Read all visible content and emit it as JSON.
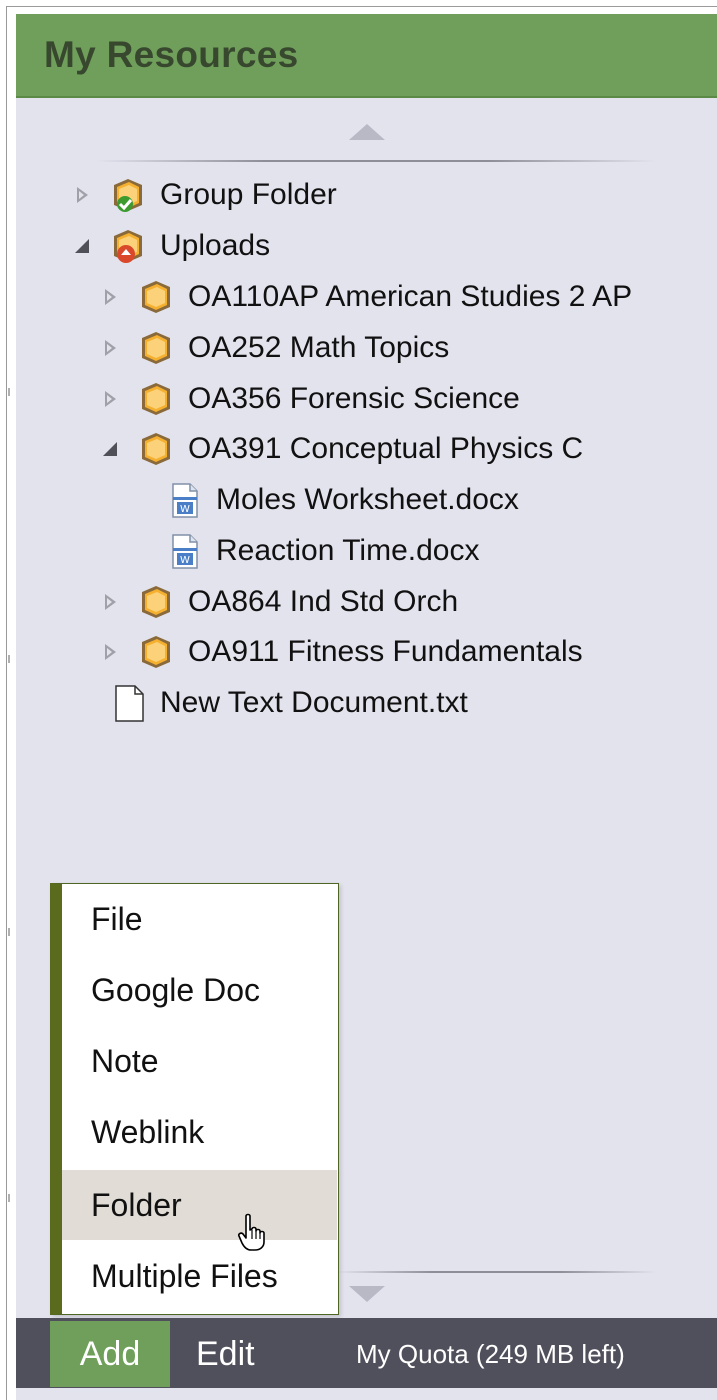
{
  "panel": {
    "title": "My Resources"
  },
  "tree": {
    "group_folder": "Group Folder",
    "uploads": "Uploads",
    "course_1": "OA110AP American Studies 2 AP",
    "course_2": "OA252 Math Topics",
    "course_3": "OA356 Forensic Science",
    "course_4": "OA391 Conceptual Physics C",
    "file_1": "Moles Worksheet.docx",
    "file_2": "Reaction Time.docx",
    "course_5": "OA864 Ind Std Orch",
    "course_6": "OA911 Fitness Fundamentals",
    "text_file": "New Text Document.txt"
  },
  "add_menu": {
    "items": [
      "File",
      "Google Doc",
      "Note",
      "Weblink",
      "Folder",
      "Multiple Files"
    ],
    "highlighted": "Folder"
  },
  "toolbar": {
    "add_label": "Add",
    "edit_label": "Edit",
    "quota_label": "My Quota (249 MB left)"
  },
  "colors": {
    "header_green": "#6f9f5a",
    "panel_bg": "#e3e3ee",
    "toolbar_bg": "#50505c",
    "menu_accent": "#5b6b1e"
  }
}
